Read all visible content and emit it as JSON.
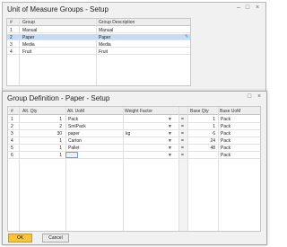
{
  "top_window": {
    "title": "Unit of Measure Groups - Setup",
    "controls": {
      "minimize": "–",
      "maximize": "□",
      "close": "×"
    },
    "columns": [
      "#",
      "Group",
      "Group Description"
    ],
    "rows": [
      {
        "num": "1",
        "group": "Manual",
        "desc": "Manual"
      },
      {
        "num": "2",
        "group": "Paper",
        "desc": "Paper"
      },
      {
        "num": "3",
        "group": "Media",
        "desc": "Media"
      },
      {
        "num": "4",
        "group": "Fruit",
        "desc": "Fruit"
      }
    ],
    "selected_row": 1,
    "edit_icon": "pencil-icon"
  },
  "bottom_window": {
    "title": "Group Definition - Paper - Setup",
    "controls": {
      "maximize": "□",
      "close": "×"
    },
    "columns": [
      "#",
      "Alt. Qty",
      "Alt. UoM",
      "Weight Factor",
      "",
      "Base Qty",
      "Base UoM"
    ],
    "rows": [
      {
        "num": "1",
        "alt_qty": "1",
        "alt_uom": "Pack",
        "weight": "",
        "eq": "=",
        "base_qty": "1",
        "base_uom": "Pack"
      },
      {
        "num": "2",
        "alt_qty": "2",
        "alt_uom": "SmlPack",
        "weight": "",
        "eq": "=",
        "base_qty": "1",
        "base_uom": "Pack"
      },
      {
        "num": "3",
        "alt_qty": "30",
        "alt_uom": "paper",
        "weight": "kg",
        "eq": "=",
        "base_qty": "6",
        "base_uom": "Pack"
      },
      {
        "num": "4",
        "alt_qty": "1",
        "alt_uom": "Carton",
        "weight": "",
        "eq": "=",
        "base_qty": "24",
        "base_uom": "Pack"
      },
      {
        "num": "5",
        "alt_qty": "1",
        "alt_uom": "Pallet",
        "weight": "",
        "eq": "=",
        "base_qty": "48",
        "base_uom": "Pack"
      },
      {
        "num": "6",
        "alt_qty": "1",
        "alt_uom": "",
        "weight": "",
        "eq": "=",
        "base_qty": "",
        "base_uom": "Pack"
      }
    ],
    "dropdown_glyph": "▼",
    "buttons": {
      "ok": "OK",
      "cancel": "Cancel"
    }
  }
}
